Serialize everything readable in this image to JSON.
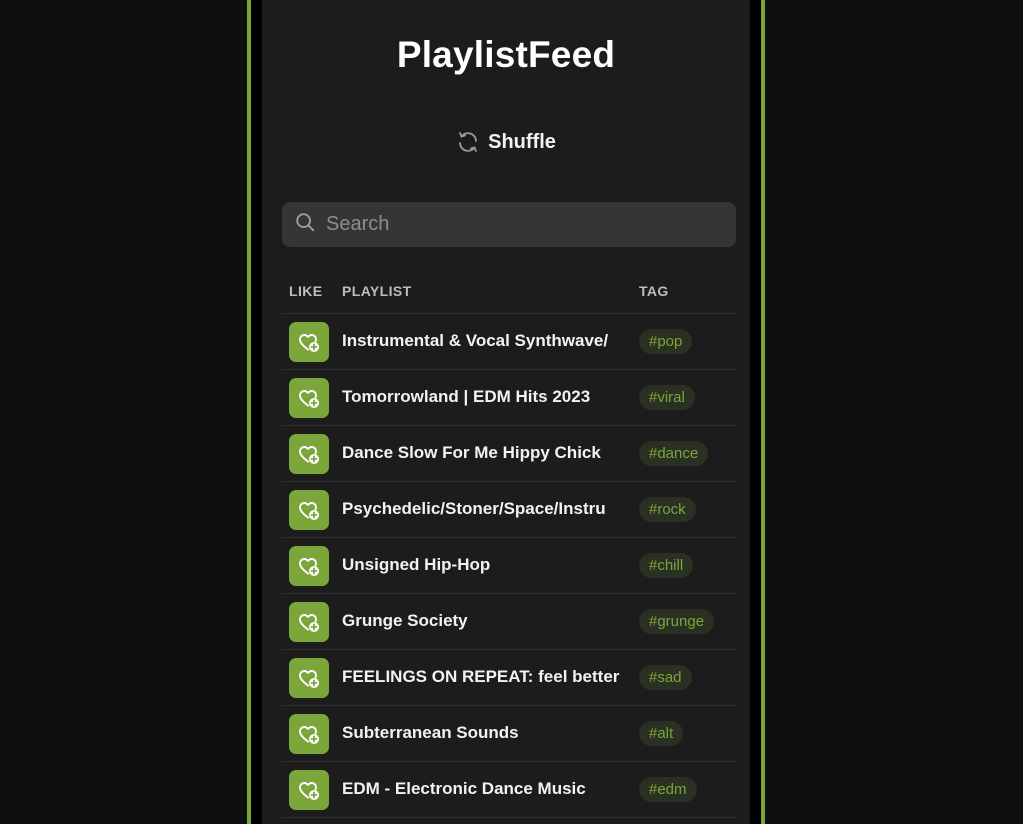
{
  "app": {
    "title": "PlaylistFeed",
    "accent_color": "#7aa63a"
  },
  "shuffle": {
    "label": "Shuffle",
    "icon": "refresh-icon"
  },
  "search": {
    "placeholder": "Search",
    "value": "",
    "icon": "search-icon"
  },
  "table": {
    "headers": {
      "like": "LIKE",
      "playlist": "PLAYLIST",
      "tag": "TAG"
    },
    "rows": [
      {
        "name": "Instrumental & Vocal Synthwave/",
        "tag": "#pop"
      },
      {
        "name": "Tomorrowland | EDM Hits 2023",
        "tag": "#viral"
      },
      {
        "name": "Dance Slow For Me Hippy Chick",
        "tag": "#dance"
      },
      {
        "name": "Psychedelic/Stoner/Space/Instru",
        "tag": "#rock"
      },
      {
        "name": "Unsigned Hip-Hop",
        "tag": "#chill"
      },
      {
        "name": "Grunge Society",
        "tag": "#grunge"
      },
      {
        "name": "FEELINGS ON REPEAT: feel better",
        "tag": "#sad"
      },
      {
        "name": "Subterranean Sounds",
        "tag": "#alt"
      },
      {
        "name": "EDM - Electronic Dance Music",
        "tag": "#edm"
      }
    ],
    "like_icon": "heart-plus-icon"
  }
}
